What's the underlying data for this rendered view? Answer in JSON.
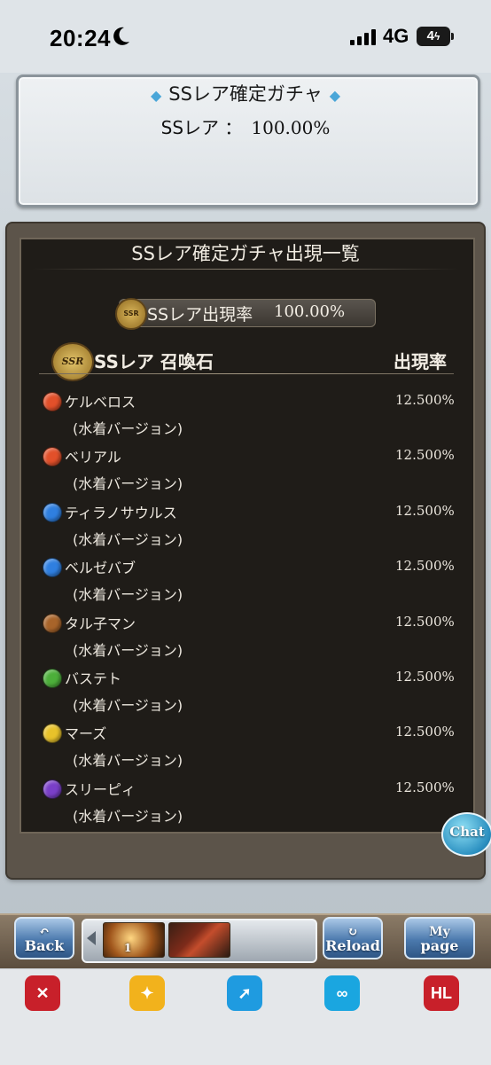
{
  "status_bar": {
    "time": "20:24",
    "network": "4G",
    "battery": "4"
  },
  "top_panel": {
    "title": "SSレア確定ガチャ",
    "rate_label": "SSレア ：",
    "rate_value": "100.00%"
  },
  "list_panel": {
    "title": "SSレア確定ガチャ出現一覧",
    "rate_pill_label": "SSレア出現率",
    "rate_pill_value": "100.00%",
    "section_badge": "SSR",
    "section_title": "SSレア 召喚石",
    "rate_header": "出現率",
    "items": [
      {
        "name": "ケルベロス",
        "sub": "(水着バージョン)",
        "rate": "12.500%",
        "element": "fire",
        "color": "#e2502a"
      },
      {
        "name": "ベリアル",
        "sub": "(水着バージョン)",
        "rate": "12.500%",
        "element": "fire",
        "color": "#e2502a"
      },
      {
        "name": "ティラノサウルス",
        "sub": "(水着バージョン)",
        "rate": "12.500%",
        "element": "water",
        "color": "#2f7fe0"
      },
      {
        "name": "ベルゼバブ",
        "sub": "(水着バージョン)",
        "rate": "12.500%",
        "element": "water",
        "color": "#2f7fe0"
      },
      {
        "name": "タル子マン",
        "sub": "(水着バージョン)",
        "rate": "12.500%",
        "element": "earth",
        "color": "#a8642a"
      },
      {
        "name": "バステト",
        "sub": "(水着バージョン)",
        "rate": "12.500%",
        "element": "wind",
        "color": "#4caf3a"
      },
      {
        "name": "マーズ",
        "sub": "(水着バージョン)",
        "rate": "12.500%",
        "element": "light",
        "color": "#e8c22a"
      },
      {
        "name": "スリーピィ",
        "sub": "(水着バージョン)",
        "rate": "12.500%",
        "element": "dark",
        "color": "#7a3fc9"
      }
    ]
  },
  "chat_button": {
    "label": "Chat"
  },
  "nav": {
    "back": {
      "line1": "",
      "line2": "Back"
    },
    "reload": {
      "line1": "",
      "line2": "Reload"
    },
    "mypage": {
      "line1": "My",
      "line2": "page"
    },
    "quick_slot_label": "1"
  },
  "dock": {
    "icons": [
      {
        "name": "sword-app-icon",
        "label": "✕",
        "color": "#c8202a"
      },
      {
        "name": "butterfly-app-icon",
        "label": "✦",
        "color": "#f2b21c"
      },
      {
        "name": "rocket-app-icon",
        "label": "➚",
        "color": "#1f9be0"
      },
      {
        "name": "infinity-app-icon",
        "label": "∞",
        "color": "#1aa6e0"
      },
      {
        "name": "hl-app-icon",
        "label": "HL",
        "color": "#c8202a"
      }
    ]
  }
}
